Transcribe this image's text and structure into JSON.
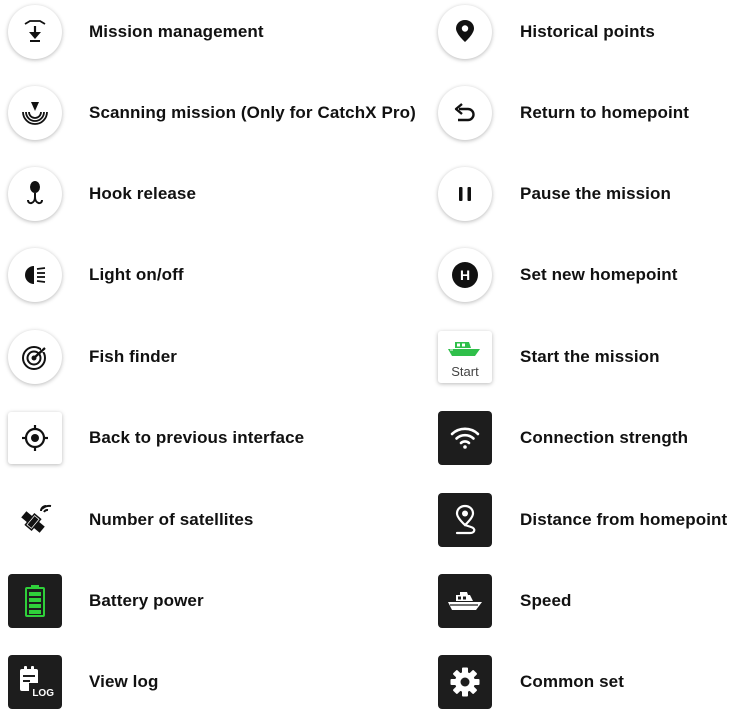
{
  "left_items": [
    {
      "label": "Mission management",
      "icon": "mission-management-icon"
    },
    {
      "label": "Scanning mission (Only for CatchX Pro)",
      "icon": "scanning-icon"
    },
    {
      "label": "Hook release",
      "icon": "hook-icon"
    },
    {
      "label": "Light on/off",
      "icon": "light-icon"
    },
    {
      "label": "Fish finder",
      "icon": "fish-finder-icon"
    },
    {
      "label": "Back to previous interface",
      "icon": "target-icon"
    },
    {
      "label": "Number of satellites",
      "icon": "satellite-icon"
    },
    {
      "label": "Battery power",
      "icon": "battery-icon"
    },
    {
      "label": "View log",
      "icon": "log-icon"
    }
  ],
  "right_items": [
    {
      "label": "Historical points",
      "icon": "map-pin-icon"
    },
    {
      "label": "Return to homepoint",
      "icon": "return-icon"
    },
    {
      "label": "Pause the mission",
      "icon": "pause-icon"
    },
    {
      "label": "Set new homepoint",
      "icon": "homepoint-h-icon"
    },
    {
      "label": "Start the mission",
      "icon": "start-boat-icon"
    },
    {
      "label": "Connection strength",
      "icon": "wifi-icon"
    },
    {
      "label": "Distance from homepoint",
      "icon": "distance-icon"
    },
    {
      "label": "Speed",
      "icon": "speed-boat-icon"
    },
    {
      "label": "Common set",
      "icon": "gear-icon"
    }
  ],
  "icon_text": {
    "start": "Start",
    "log": "LOG",
    "homepoint_letter": "H"
  },
  "colors": {
    "battery_green": "#2fd03a",
    "boat_green": "#2fbf4a",
    "dark_tile": "#1d1d1d"
  }
}
